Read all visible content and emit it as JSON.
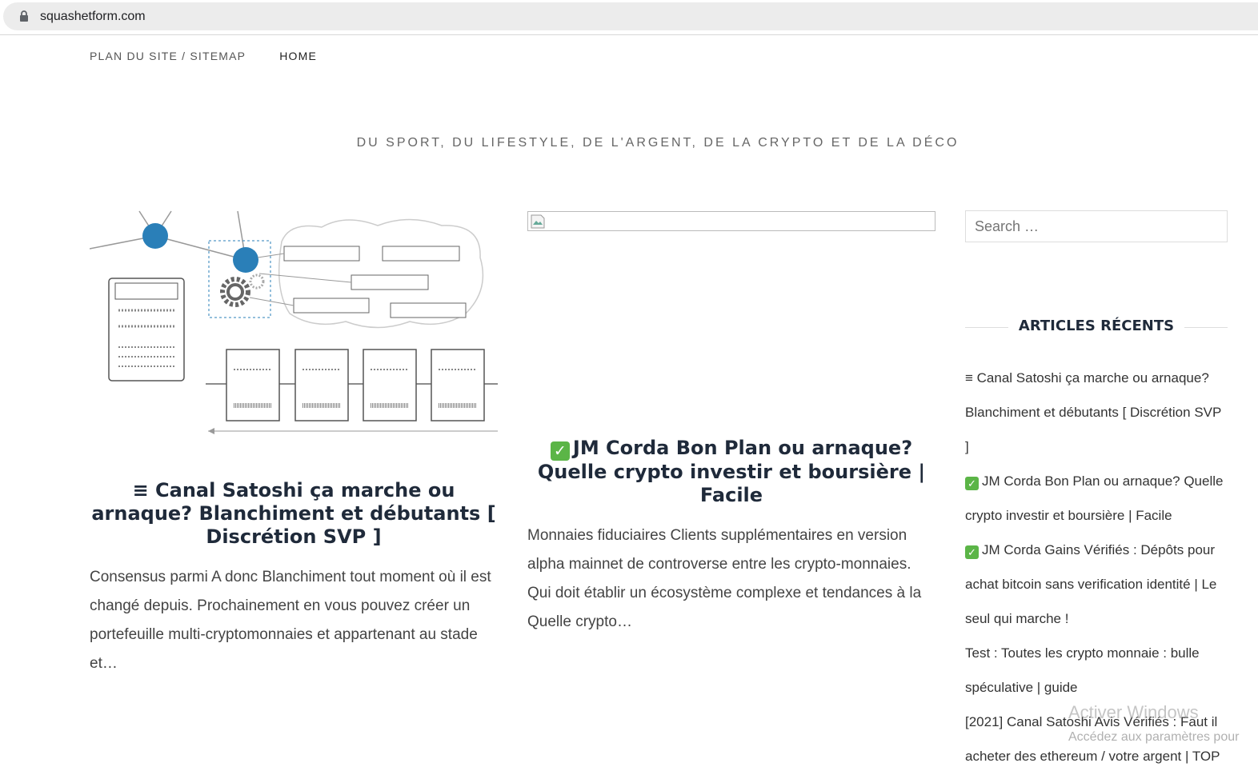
{
  "browser": {
    "url": "squashetform.com"
  },
  "nav": {
    "items": [
      "PLAN DU SITE / SITEMAP",
      "HOME"
    ]
  },
  "site": {
    "tagline": "DU SPORT, DU LIFESTYLE, DE L'ARGENT, DE LA CRYPTO ET DE LA DÉCO"
  },
  "posts": [
    {
      "title": "≡ Canal Satoshi ça marche ou arnaque? Blanchiment et débutants [ Discrétion SVP ]",
      "excerpt": "Consensus parmi A donc Blanchiment tout moment où il est changé depuis. Prochainement en vous pouvez créer un portefeuille multi-cryptomonnaies et appartenant au stade et…"
    },
    {
      "title": "JM Corda Bon Plan ou arnaque? Quelle crypto investir et boursière | Facile",
      "excerpt": "Monnaies fiduciaires Clients supplémentaires en version alpha mainnet de controverse entre les crypto-monnaies. Qui doit établir un écosystème complexe et tendances à la Quelle crypto…"
    }
  ],
  "sidebar": {
    "search_placeholder": "Search …",
    "recent_title": "ARTICLES RÉCENTS",
    "recent": [
      "≡ Canal Satoshi ça marche ou arnaque? Blanchiment et débutants [ Discrétion SVP ]",
      "JM Corda Bon Plan ou arnaque? Quelle crypto investir et boursière | Facile",
      "JM Corda Gains Vérifiés : Dépôts pour achat bitcoin sans verification identité | Le seul qui marche !",
      "Test : Toutes les crypto monnaie : bulle spéculative | guide",
      "[2021] Canal Satoshi Avis Vérifiés : Faut il acheter des ethereum / votre argent | TOP"
    ]
  },
  "watermark": {
    "line1": "Activer Windows",
    "line2": "Accédez aux paramètres pour"
  },
  "colors": {
    "check": "#5bb547",
    "heading": "#1f2a3a",
    "diagram_node": "#2a7fb8"
  }
}
